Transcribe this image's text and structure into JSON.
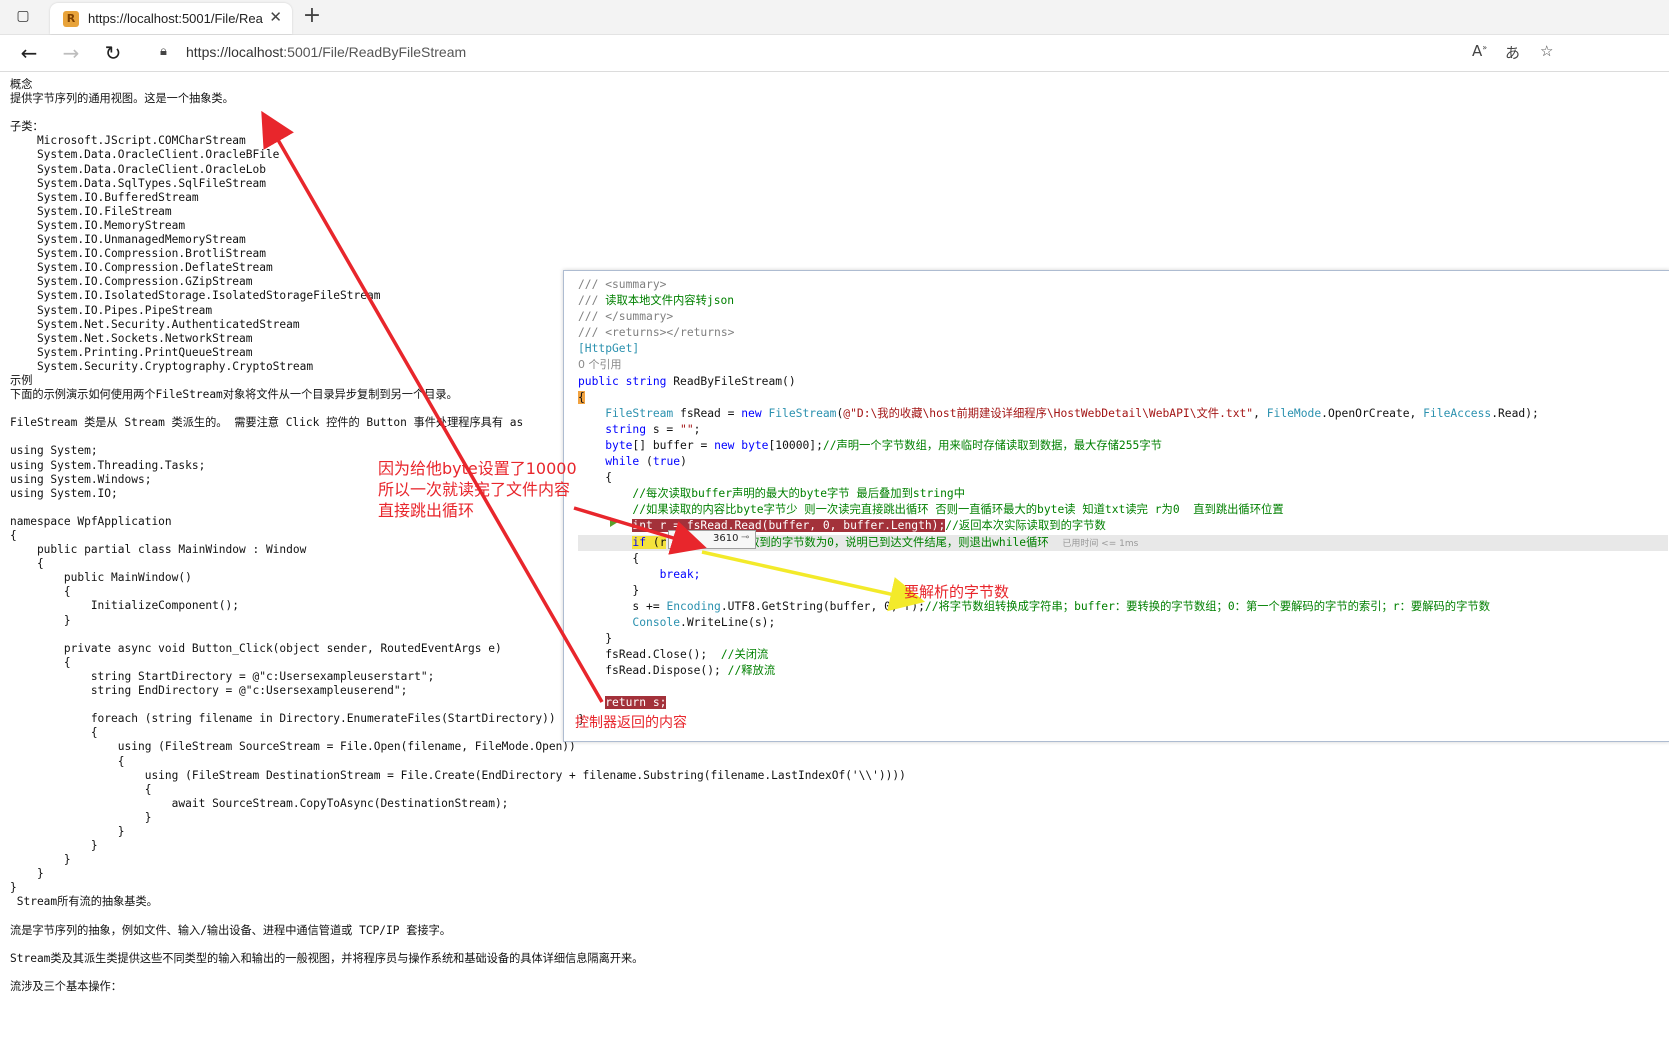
{
  "browser": {
    "tab_title": "https://localhost:5001/File/ReadB",
    "tab_favicon_letter": "R",
    "url_host": "https://localhost",
    "url_rest": ":5001/File/ReadByFileStream"
  },
  "page_lines": [
    "概念",
    "提供字节序列的通用视图。这是一个抽象类。",
    "",
    "子类：",
    "    Microsoft.JScript.COMCharStream",
    "    System.Data.OracleClient.OracleBFile",
    "    System.Data.OracleClient.OracleLob",
    "    System.Data.SqlTypes.SqlFileStream",
    "    System.IO.BufferedStream",
    "    System.IO.FileStream",
    "    System.IO.MemoryStream",
    "    System.IO.UnmanagedMemoryStream",
    "    System.IO.Compression.BrotliStream",
    "    System.IO.Compression.DeflateStream",
    "    System.IO.Compression.GZipStream",
    "    System.IO.IsolatedStorage.IsolatedStorageFileStream",
    "    System.IO.Pipes.PipeStream",
    "    System.Net.Security.AuthenticatedStream",
    "    System.Net.Sockets.NetworkStream",
    "    System.Printing.PrintQueueStream",
    "    System.Security.Cryptography.CryptoStream",
    "示例",
    "下面的示例演示如何使用两个FileStream对象将文件从一个目录异步复制到另一个目录。",
    "",
    "FileStream 类是从 Stream 类派生的。 需要注意 Click 控件的 Button 事件处理程序具有 as",
    "",
    "using System;",
    "using System.Threading.Tasks;",
    "using System.Windows;",
    "using System.IO;",
    "",
    "namespace WpfApplication",
    "{",
    "    public partial class MainWindow : Window",
    "    {",
    "        public MainWindow()",
    "        {",
    "            InitializeComponent();",
    "        }",
    "",
    "        private async void Button_Click(object sender, RoutedEventArgs e)",
    "        {",
    "            string StartDirectory = @\"c:Usersexampleuserstart\";",
    "            string EndDirectory = @\"c:Usersexampleuserend\";",
    "",
    "            foreach (string filename in Directory.EnumerateFiles(StartDirectory))",
    "            {",
    "                using (FileStream SourceStream = File.Open(filename, FileMode.Open))",
    "                {",
    "                    using (FileStream DestinationStream = File.Create(EndDirectory + filename.Substring(filename.LastIndexOf('\\\\'))))",
    "                    {",
    "                        await SourceStream.CopyToAsync(DestinationStream);",
    "                    }",
    "                }",
    "            }",
    "        }",
    "    }",
    "}",
    " Stream所有流的抽象基类。",
    "",
    "流是字节序列的抽象，例如文件、输入/输出设备、进程中通信管道或 TCP/IP 套接字。",
    "",
    "Stream类及其派生类提供这些不同类型的输入和输出的一般视图，并将程序员与操作系统和基础设备的具体详细信息隔离开来。",
    "",
    "流涉及三个基本操作："
  ],
  "code": {
    "l1": "/// <summary>",
    "l2_prefix": "/// ",
    "l2_text": "读取本地文件内容转json",
    "l3": "/// </summary>",
    "l4": "/// <returns></returns>",
    "l5": "[HttpGet]",
    "refs": "0 个引用",
    "l6_kw": "public string",
    "l6_rest": " ReadByFileStream()",
    "brace_open": "{",
    "l8_type": "FileStream",
    "l8_var": " fsRead = ",
    "l8_new": "new",
    "l8_type2": " FileStream",
    "l8_paren": "(",
    "l8_str": "@\"D:\\我的收藏\\host前期建设详细程序\\HostWebDetail\\WebAPI\\文件.txt\"",
    "l8_comma": ", ",
    "l8_fm": "FileMode",
    "l8_fm2": ".OpenOrCreate, ",
    "l8_fa": "FileAccess",
    "l8_fa2": ".Read);",
    "l9_kw": "string",
    "l9_rest": " s = ",
    "l9_str": "\"\"",
    "l9_end": ";",
    "l10_kw": "byte",
    "l10_a": "[] buffer = ",
    "l10_new": "new",
    "l10_kw2": " byte",
    "l10_b": "[10000];",
    "l10_cm": "//声明一个字节数组，用来临时存储读取到数据，最大存储255字节",
    "l11_kw": "while",
    "l11_a": " (",
    "l11_kw2": "true",
    "l11_b": ")",
    "l12": "{",
    "l13": "//每次读取buffer声明的最大的byte字节 最后叠加到string中",
    "l14": "//如果读取的内容比byte字节少 则一次读完直接跳出循环 否则一直循环最大的byte读 知道txt读完 r为0  直到跳出循环位置",
    "l15_code": "int r = fsRead.Read(buffer, 0, buffer.Length);",
    "l15_cm": "//返回本次实际读取到的字节数",
    "l16_kw": "if",
    "l16_a": " (r",
    "l16_cm": "取到的字节数为0，说明已到达文件结尾，则退出while循环",
    "elapsed": "已用时间 <= 1ms",
    "l17": "{",
    "l18": "break;",
    "l19": "}",
    "l20_a": "s += ",
    "l20_tp": "Encoding",
    "l20_b": ".UTF8.GetString(buffer, 0, r);",
    "l20_cm": "//将字节数组转换成字符串；buffer：要转换的字节数组；0：第一个要解码的字节的索引；r：要解码的字节数",
    "l21_tp": "Console",
    "l21_b": ".WriteLine(s);",
    "l22": "}",
    "l23_a": "fsRead.Close();  ",
    "l23_cm": "//关闭流",
    "l24_a": "fsRead.Dispose(); ",
    "l24_cm": "//释放流",
    "l25": "return s;",
    "brace_close": "}"
  },
  "datatip": {
    "name": "r",
    "value": "3610"
  },
  "annotations": {
    "byte_note_1": "因为给他byte设置了10000",
    "byte_note_2": "所以一次就读完了文件内容",
    "byte_note_3": "直接跳出循环",
    "bytes_to_parse": "要解析的字节数",
    "controller_return": "控制器返回的内容"
  },
  "colors": {
    "annotation_red": "#e8262c",
    "annotation_yellow": "#f3ea2a",
    "comment_green": "#008000",
    "keyword_blue": "#0000ff",
    "type_teal": "#2b91af",
    "string_red": "#a31515"
  }
}
